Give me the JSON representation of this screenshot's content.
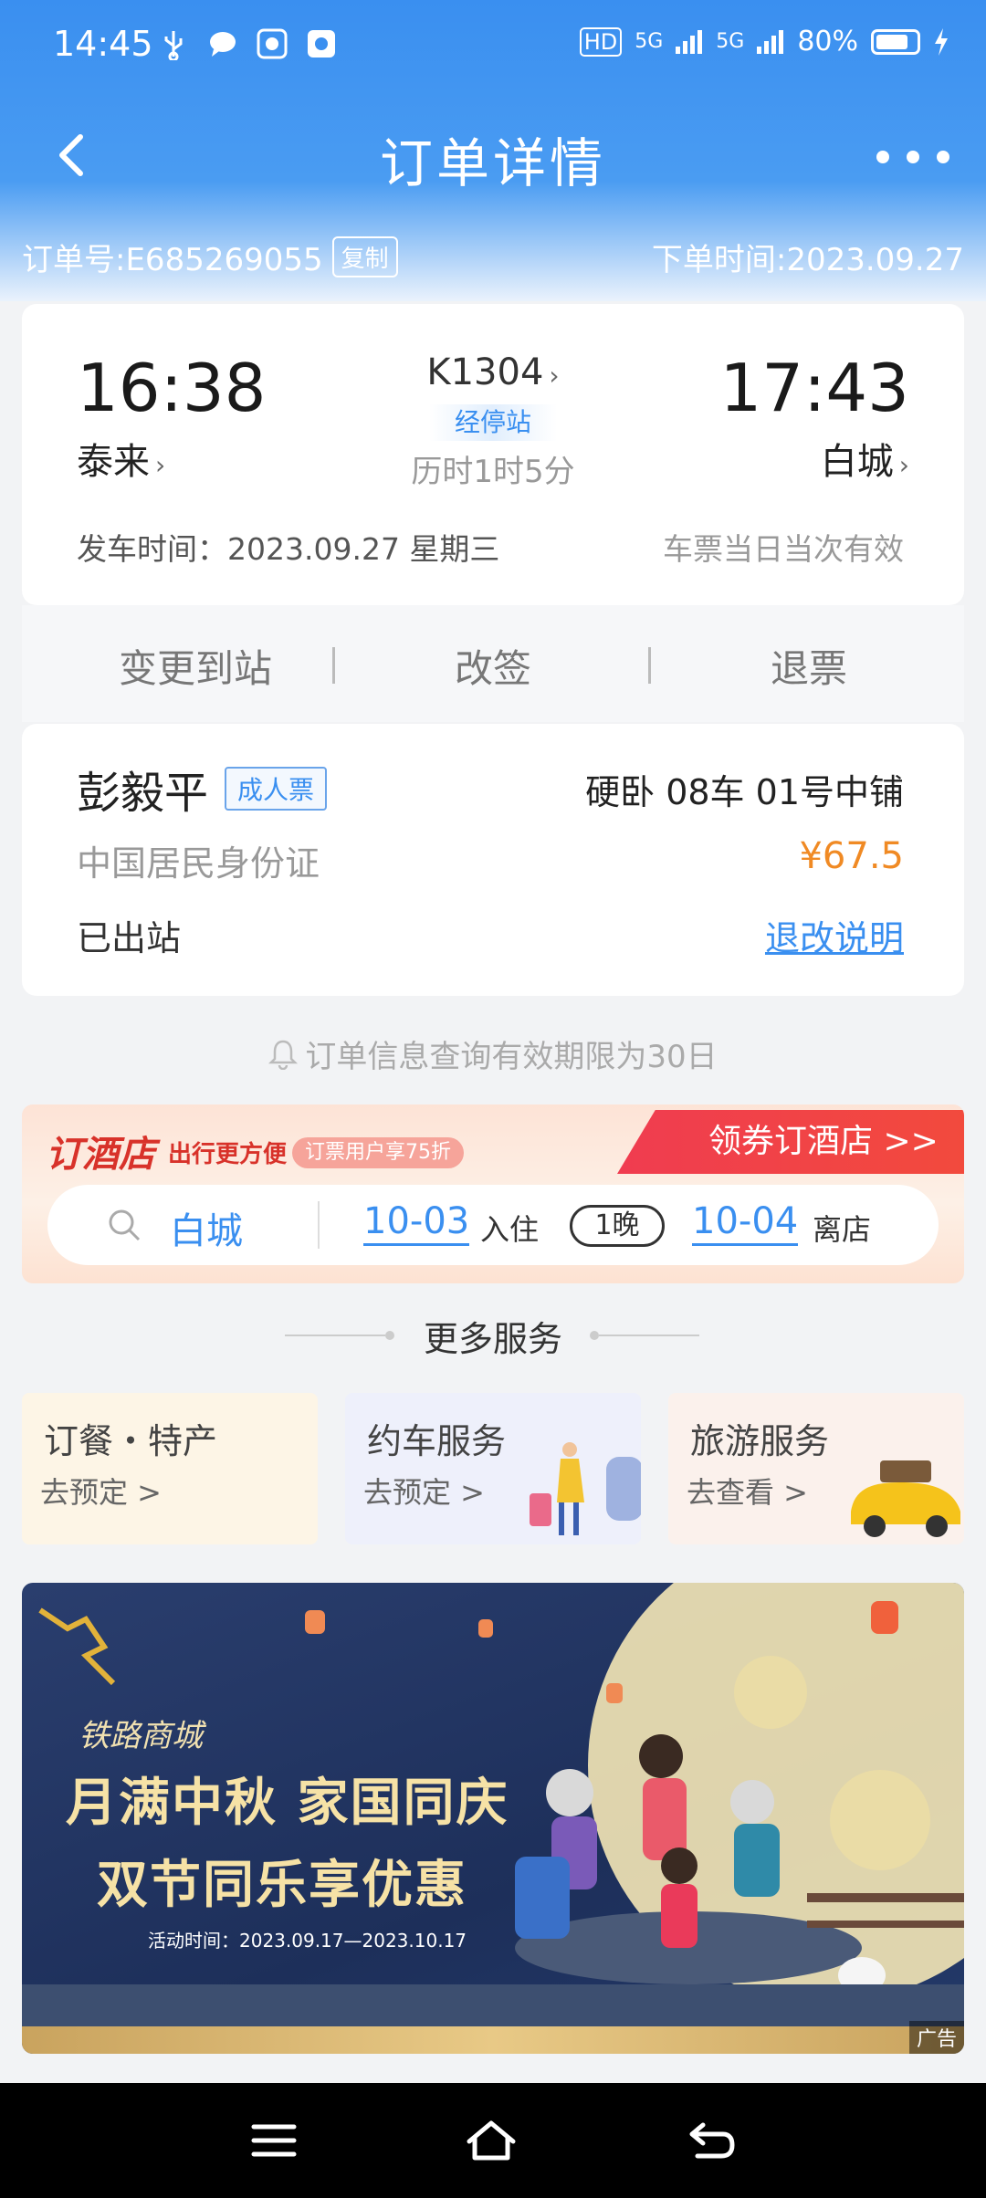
{
  "status_bar": {
    "time": "14:45",
    "battery": "80%",
    "battery_level": 0.8,
    "signal1": "5G",
    "signal2": "5G",
    "hd": "HD"
  },
  "nav": {
    "title": "订单详情"
  },
  "order": {
    "number": "订单号:E685269055",
    "copy_label": "复制",
    "time": "下单时间:2023.09.27"
  },
  "trip": {
    "depart_time": "16:38",
    "depart_station": "泰来",
    "arrive_time": "17:43",
    "arrive_station": "白城",
    "train_no": "K1304",
    "via_label": "经停站",
    "duration": "历时1时5分",
    "depart_date": "发车时间：2023.09.27 星期三",
    "valid_note": "车票当日当次有效"
  },
  "actions": {
    "change_station": "变更到站",
    "reschedule": "改签",
    "refund": "退票"
  },
  "passenger": {
    "name": "彭毅平",
    "ticket_type": "成人票",
    "seat": "硬卧 08车 01号中铺",
    "id_type": "中国居民身份证",
    "price": "¥67.5",
    "status": "已出站",
    "refund_link": "退改说明"
  },
  "notice": "订单信息查询有效期限为30日",
  "hotel": {
    "title": "订酒店",
    "subtitle": "出行更方便",
    "promo": "订票用户享75折",
    "cta": "领券订酒店 >>",
    "city": "白城",
    "checkin_date": "10-03",
    "checkin_label": "入住",
    "nights": "1晚",
    "checkout_date": "10-04",
    "checkout_label": "离店"
  },
  "services": {
    "title": "更多服务",
    "items": [
      {
        "title": "订餐・特产",
        "link": "去预定 >",
        "bg": "#fdf5e6"
      },
      {
        "title": "约车服务",
        "link": "去预定 >",
        "bg": "#eef0fb"
      },
      {
        "title": "旅游服务",
        "link": "去查看 >",
        "bg": "#fbf1ec"
      }
    ]
  },
  "promo": {
    "brand": "铁路商城",
    "line1": "月满中秋 家国同庆",
    "line2": "双节同乐享优惠",
    "date": "活动时间：2023.09.17—2023.10.17",
    "ad_tag": "广告"
  },
  "colors": {
    "header_blue": "#3a8ff0",
    "price_orange": "#f08a24",
    "hotel_red": "#d8322a"
  }
}
